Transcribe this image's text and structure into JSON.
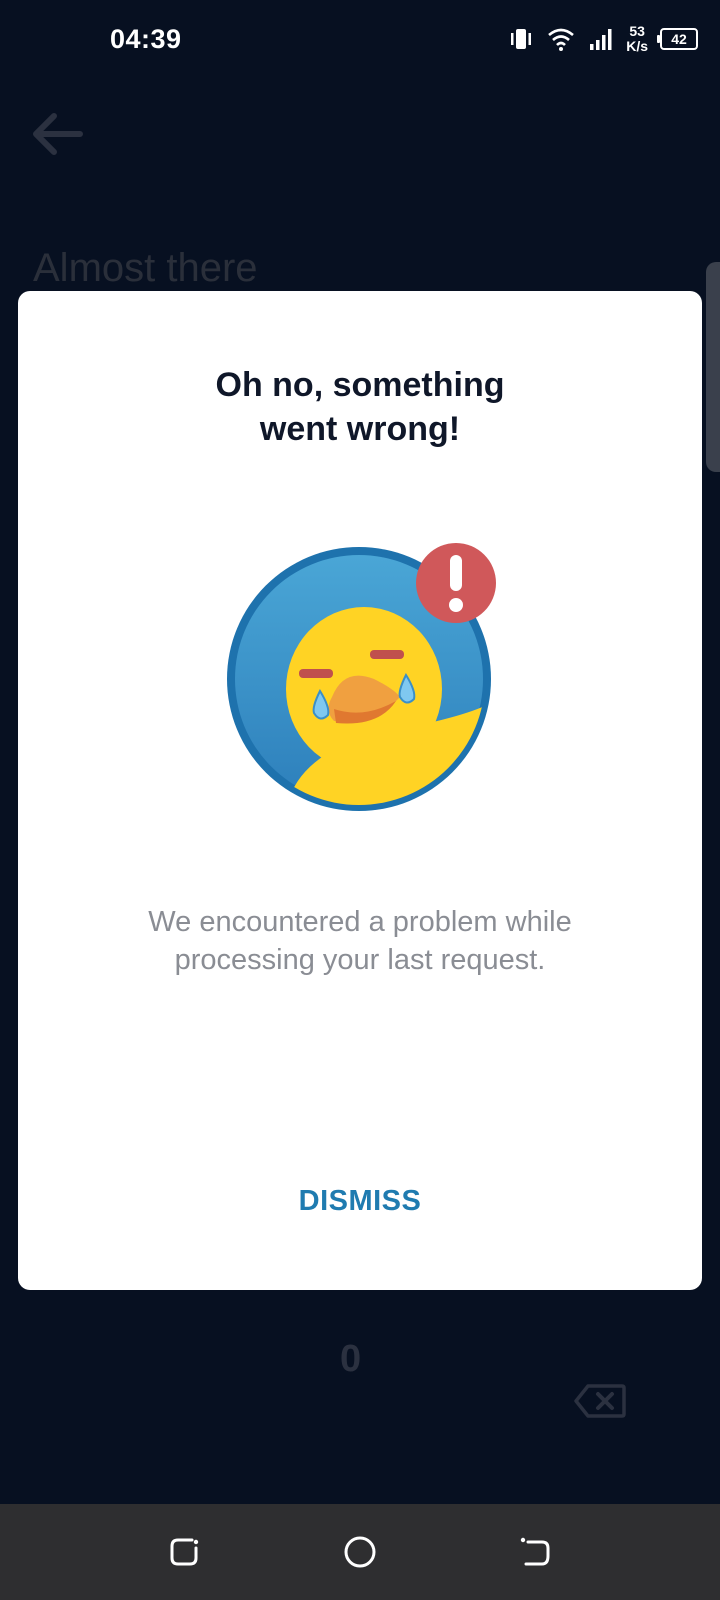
{
  "status_bar": {
    "time": "04:39",
    "net_speed_value": "53",
    "net_speed_unit": "K/s",
    "battery": "42",
    "icons": [
      "vibrate-icon",
      "wifi-icon",
      "signal-icon",
      "battery-icon"
    ]
  },
  "background": {
    "title": "Almost there",
    "keypad_zero": "0",
    "icons": [
      "back-arrow-icon",
      "delete-key-icon"
    ]
  },
  "dialog": {
    "title_line1": "Oh no, something",
    "title_line2": "went wrong!",
    "message_line1": "We encountered a problem while",
    "message_line2": "processing your last request.",
    "dismiss_label": "DISMISS",
    "illustration": "crying-duck-error-illustration"
  },
  "nav_bar": {
    "icons": [
      "recents-icon",
      "home-icon",
      "back-icon"
    ]
  },
  "colors": {
    "background": "#071021",
    "dialog": "#ffffff",
    "accent": "#1f7bb0",
    "error_badge": "#d0585a",
    "duck": "#ffd324"
  }
}
